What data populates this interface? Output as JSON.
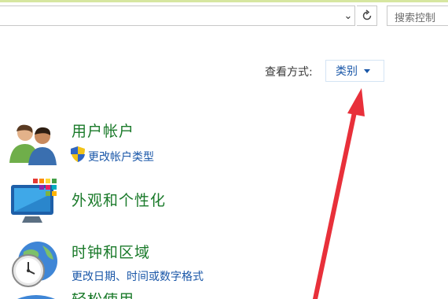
{
  "search": {
    "placeholder": "搜索控制"
  },
  "view": {
    "label": "查看方式:",
    "value": "类别"
  },
  "categories": [
    {
      "title": "用户帐户",
      "link": "更改帐户类型",
      "icon": "users-icon"
    },
    {
      "title": "外观和个性化",
      "icon": "monitor-icon"
    },
    {
      "title": "时钟和区域",
      "link": "更改日期、时间或数字格式",
      "icon": "clock-globe-icon"
    },
    {
      "title": "轻松使用",
      "icon": "ease-of-access-icon"
    }
  ],
  "colors": {
    "title": "#1a7a2a",
    "link": "#1a57a8",
    "annotation_arrow": "#e8303a"
  }
}
